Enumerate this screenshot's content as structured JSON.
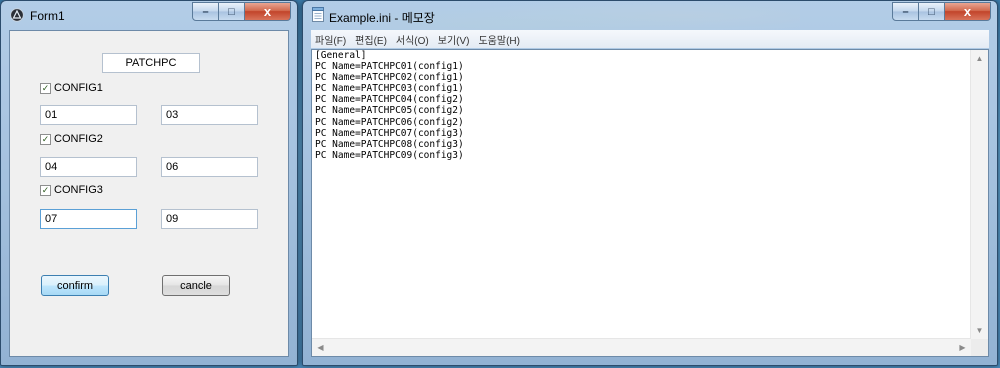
{
  "form1": {
    "title": "Form1",
    "controls": {
      "minimize": "–",
      "maximize": "□",
      "close": "x"
    },
    "header_field": "PATCHPC",
    "groups": [
      {
        "label": "CONFIG1",
        "checked": "✓",
        "field_a": "01",
        "field_b": "03"
      },
      {
        "label": "CONFIG2",
        "checked": "✓",
        "field_a": "04",
        "field_b": "06"
      },
      {
        "label": "CONFIG3",
        "checked": "✓",
        "field_a": "07",
        "field_b": "09"
      }
    ],
    "confirm_label": "confirm",
    "cancel_label": "cancle"
  },
  "notepad": {
    "title": "Example.ini - 메모장",
    "controls": {
      "minimize": "–",
      "maximize": "□",
      "close": "x"
    },
    "menu": [
      "파일(F)",
      "편집(E)",
      "서식(O)",
      "보기(V)",
      "도움말(H)"
    ],
    "lines": [
      "[General]",
      "PC Name=PATCHPC01(config1)",
      "PC Name=PATCHPC02(config1)",
      "PC Name=PATCHPC03(config1)",
      "PC Name=PATCHPC04(config2)",
      "PC Name=PATCHPC05(config2)",
      "PC Name=PATCHPC06(config2)",
      "PC Name=PATCHPC07(config3)",
      "PC Name=PATCHPC08(config3)",
      "PC Name=PATCHPC09(config3)"
    ]
  },
  "colors": {
    "titlebar": "#b9d1ea",
    "close_button": "#c2442a",
    "default_button": "#bee6fd"
  }
}
